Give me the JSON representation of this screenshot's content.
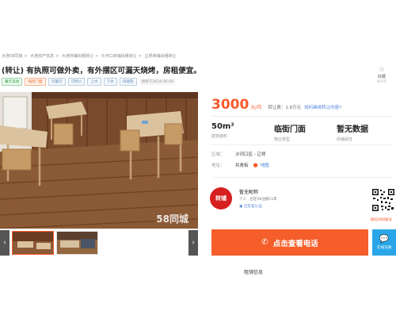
{
  "breadcrumb": [
    "大连58同城",
    "大连房产信息",
    "大连商铺出租转让",
    "沙河口商铺出租转让",
    "辽师商铺出租转让"
  ],
  "title": "(转让) 有执照可做外卖，有外摆区可漏天烧烤，房租便宜。",
  "tags": [
    {
      "text": "餐饮美食",
      "style": "green"
    },
    {
      "text": "临街门面",
      "style": "orange"
    },
    {
      "text": "可餐饮",
      "style": "blue"
    },
    {
      "text": "可明火",
      "style": "blue"
    },
    {
      "text": "上水",
      "style": "blue"
    },
    {
      "text": "下水",
      "style": "blue"
    },
    {
      "text": "排烟管",
      "style": "blue"
    }
  ],
  "updated": "更新于2024-06-06",
  "favorite": {
    "icon": "star-outline-icon",
    "label": "收藏",
    "views": "0人气"
  },
  "gallery": {
    "watermark": "58同城",
    "prev": "‹",
    "next": "›"
  },
  "price": {
    "amount": "3000",
    "unit": "元/月",
    "transfer_fee": "转让费：1.8万元",
    "transfer_question": "如何具体转让内容?"
  },
  "stats": [
    {
      "value": "50m²",
      "label": "建筑面积"
    },
    {
      "value": "临街门面",
      "label": "物业类型"
    },
    {
      "value": "暂无数据",
      "label": "商铺属性"
    }
  ],
  "info": {
    "district_label": "区域：",
    "district_value": "沙河口区 - 辽师",
    "address_label": "地址：",
    "address_value": "共青街",
    "map_link": "地图"
  },
  "poster": {
    "avatar_text": "转铺",
    "name": "暂无昵称",
    "type": "个人",
    "tenure": "已在58注册11年",
    "verify": "已实名认证"
  },
  "qr": {
    "caption": "微信扫码拨号"
  },
  "actions": {
    "call": "点击查看电话",
    "chat": "在线沟通"
  },
  "bottom": {
    "text": "租铺信息"
  }
}
